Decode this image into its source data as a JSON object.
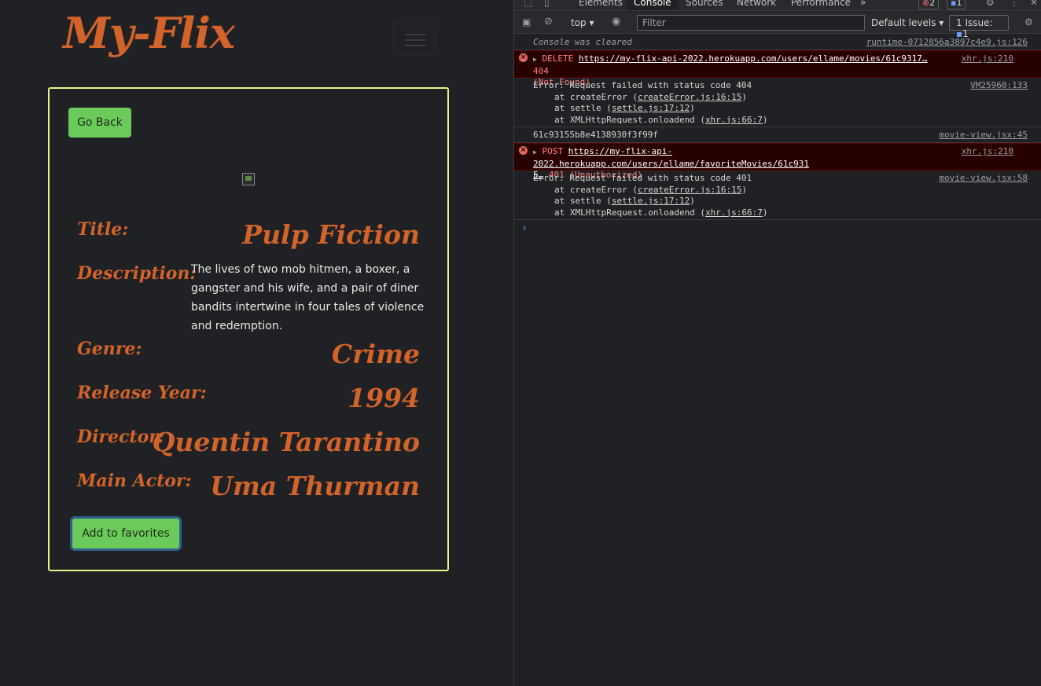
{
  "app": {
    "brand": "My-Flix",
    "go_back_label": "Go Back",
    "add_favorites_label": "Add to favorites",
    "movie": {
      "title_label": "Title:",
      "title": "Pulp Fiction",
      "description_label": "Description:",
      "description": "The lives of two mob hitmen, a boxer, a gangster and his wife, and a pair of diner bandits intertwine in four tales of violence and redemption.",
      "genre_label": "Genre:",
      "genre": "Crime",
      "release_year_label": "Release Year:",
      "release_year": "1994",
      "director_label": "Director:",
      "director": "Quentin Tarantino",
      "main_actor_label": "Main Actor:",
      "main_actor": "Uma Thurman"
    }
  },
  "devtools": {
    "tabs": [
      "Elements",
      "Console",
      "Sources",
      "Network",
      "Performance"
    ],
    "active_tab": "Console",
    "more_tabs": "»",
    "error_count": "2",
    "message_count": "1",
    "context": "top",
    "filter_placeholder": "Filter",
    "levels": "Default levels",
    "issues_label": "1 Issue:",
    "issues_count": "1",
    "messages": [
      {
        "text": "Console was cleared",
        "source": "runtime-0712856a3897c4e9.js:126"
      },
      {
        "method": "DELETE",
        "url": "https://my-flix-api-2022.herokuapp.com/users/ellame/movies/61c9317…",
        "status": "404",
        "status_text": "(Not Found)",
        "source": "xhr.js:210"
      },
      {
        "line1": "Error: Request failed with status code 404",
        "at1_prefix": "at createError (",
        "at1_link": "createError.js:16:15",
        "at2_prefix": "at settle (",
        "at2_link": "settle.js:17:12",
        "at3_prefix": "at XMLHttpRequest.onloadend (",
        "at3_link": "xhr.js:66:7",
        "suffix": ")",
        "source": "VM25960:133"
      },
      {
        "text": "61c93155b8e4138930f3f99f",
        "source": "movie-view.jsx:45"
      },
      {
        "method": "POST",
        "url": "https://my-flix-api-2022.herokuapp.com/users/ellame/favoriteMovies/61c931",
        "url2": "5…",
        "status": "401",
        "status_text": "(Unauthorized)",
        "source": "xhr.js:210"
      },
      {
        "line1": "Error: Request failed with status code 401",
        "at1_prefix": "at createError (",
        "at1_link": "createError.js:16:15",
        "at2_prefix": "at settle (",
        "at2_link": "settle.js:17:12",
        "at3_prefix": "at XMLHttpRequest.onloadend (",
        "at3_link": "xhr.js:66:7",
        "suffix": ")",
        "source": "movie-view.jsx:58"
      }
    ],
    "prompt_symbol": "›"
  },
  "icons": {
    "inspect": "inspect-icon",
    "device": "device-toolbar-icon",
    "sidebar": "sidebar-toggle-icon",
    "clear": "clear-console-icon",
    "eye": "live-expression-icon",
    "gear": "gear-icon",
    "kebab": "more-options-icon",
    "close": "close-icon",
    "error": "error-icon"
  },
  "colors": {
    "accent": "#d2632a",
    "button": "#6bcb5a",
    "card_border": "#e6f58a",
    "error_bg": "#290000",
    "error_text": "#ff8080"
  }
}
